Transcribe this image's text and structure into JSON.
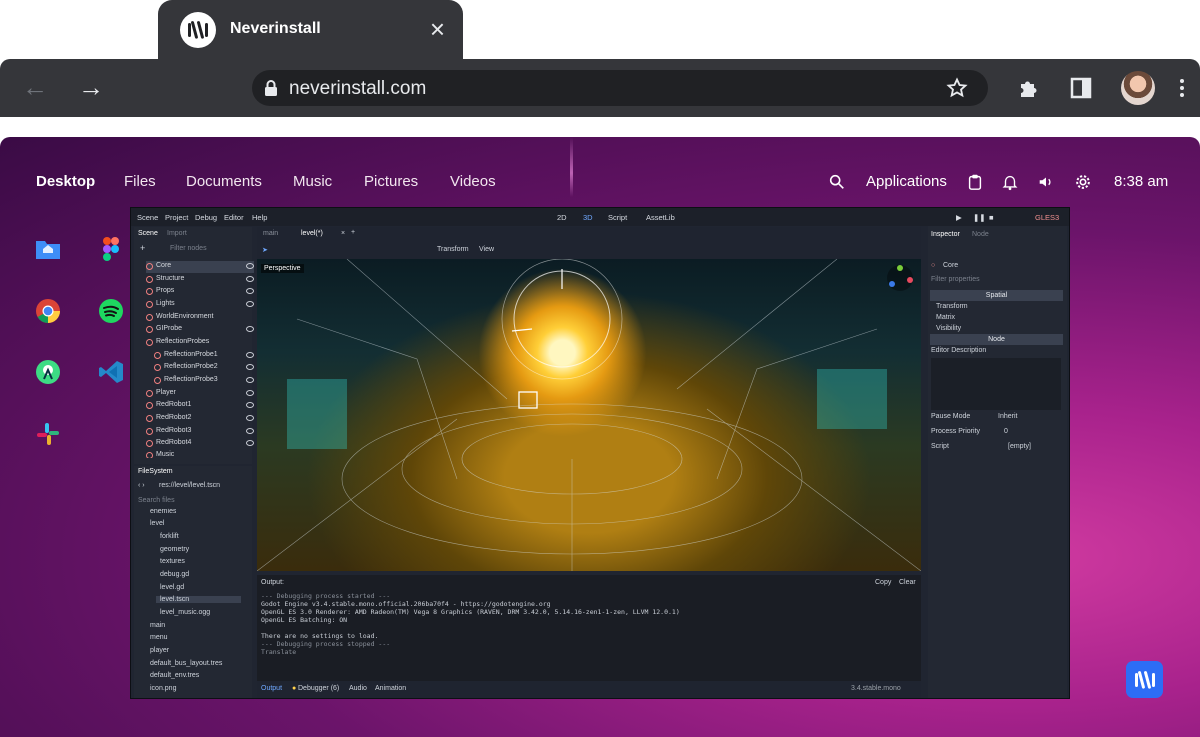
{
  "browser": {
    "tab_title": "Neverinstall",
    "url": "neverinstall.com",
    "icons": [
      "back-arrow-icon",
      "forward-arrow-icon",
      "lock-icon",
      "star-icon",
      "extensions-icon",
      "sidepanel-icon",
      "profile-avatar",
      "kebab-menu-icon"
    ]
  },
  "desktop": {
    "nav": [
      "Desktop",
      "Files",
      "Documents",
      "Music",
      "Pictures",
      "Videos"
    ],
    "applications_label": "Applications",
    "clock": "8:38 am",
    "dock_apps": [
      "home-folder",
      "figma",
      "chrome",
      "spotify",
      "android-studio",
      "vscode",
      "slack"
    ],
    "accent": "#2d6df6"
  },
  "godot": {
    "menu": [
      "Scene",
      "Project",
      "Debug",
      "Editor",
      "Help"
    ],
    "modes": [
      "2D",
      "3D",
      "Script",
      "AssetLib"
    ],
    "renderer": "GLES3",
    "scene_tabs": [
      "Scene",
      "Import"
    ],
    "filter_placeholder": "Filter nodes",
    "scene_tree": [
      "Core",
      "Structure",
      "Props",
      "Lights",
      "WorldEnvironment",
      "GIProbe",
      "ReflectionProbes",
      "ReflectionProbe1",
      "ReflectionProbe2",
      "ReflectionProbe3",
      "Player",
      "RedRobot1",
      "RedRobot2",
      "RedRobot3",
      "RedRobot4",
      "Music"
    ],
    "editor_tabs": [
      "main",
      "level(*)"
    ],
    "viewport_menu": [
      "Transform",
      "View"
    ],
    "viewport_label": "Perspective",
    "filesystem_title": "FileSystem",
    "fs_path": "res://level/level.tscn",
    "fs_search_placeholder": "Search files",
    "fs_items": [
      "enemies",
      "level",
      "forklift",
      "geometry",
      "textures",
      "debug.gd",
      "level.gd",
      "level.tscn",
      "level_music.ogg",
      "main",
      "menu",
      "player",
      "default_bus_layout.tres",
      "default_env.tres",
      "icon.png"
    ],
    "output_title": "Output:",
    "output_buttons": [
      "Copy",
      "Clear"
    ],
    "output_lines": [
      "--- Debugging process started ---",
      "Godot Engine v3.4.stable.mono.official.206ba70f4 - https://godotengine.org",
      "OpenGL ES 3.0 Renderer: AMD Radeon(TM) Vega 8 Graphics (RAVEN, DRM 3.42.0, 5.14.16-zen1-1-zen, LLVM 12.0.1)",
      "OpenGL ES Batching: ON",
      "",
      "There are no settings to load.",
      "--- Debugging process stopped ---",
      "Translate"
    ],
    "bottom_tabs": [
      "Output",
      "Debugger (6)",
      "Audio",
      "Animation"
    ],
    "version": "3.4.stable.mono",
    "inspector_tabs": [
      "Inspector",
      "Node"
    ],
    "inspector_node": "Core",
    "inspector_filter": "Filter properties",
    "sections": [
      "Spatial",
      "Transform",
      "Matrix",
      "Visibility",
      "Node"
    ],
    "editor_description": "Editor Description",
    "props": [
      {
        "label": "Pause Mode",
        "value": "Inherit"
      },
      {
        "label": "Process Priority",
        "value": "0"
      },
      {
        "label": "Script",
        "value": "[empty]"
      }
    ]
  }
}
